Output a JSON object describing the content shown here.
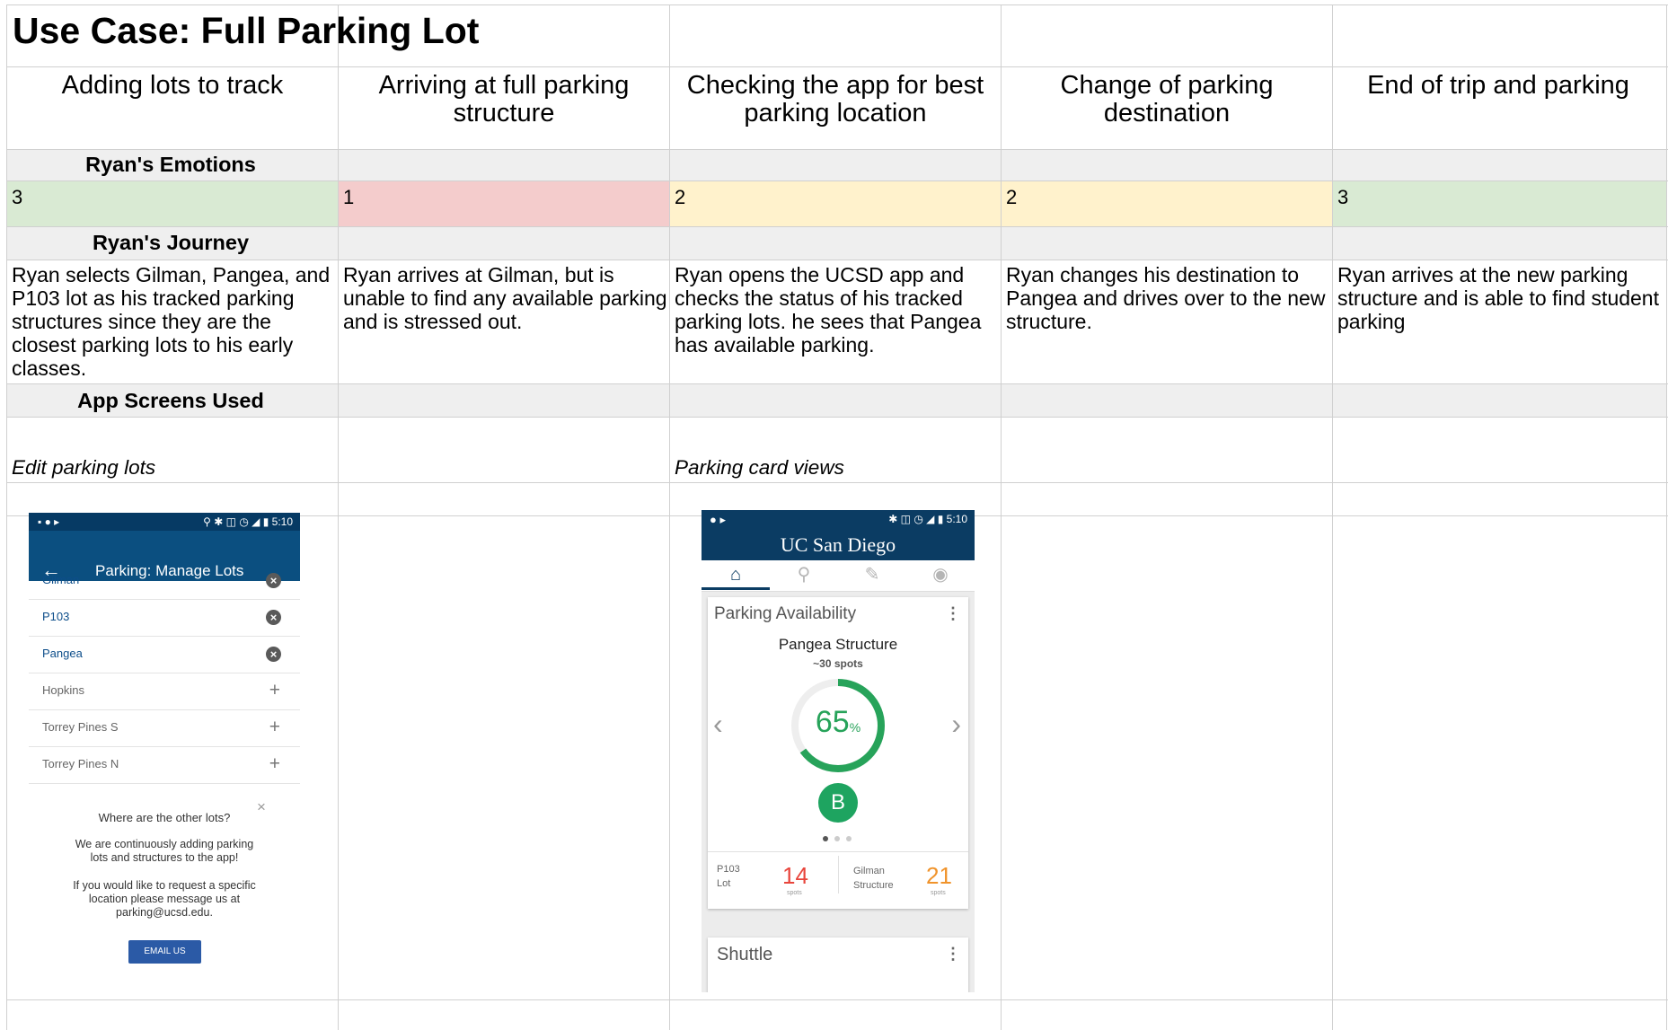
{
  "title": "Use Case: Full Parking Lot",
  "phases": [
    "Adding lots to track",
    "Arriving at full parking structure",
    "Checking the app for best parking location",
    "Change of parking destination",
    "End of trip and parking"
  ],
  "sections": {
    "emotions": "Ryan's Emotions",
    "journey": "Ryan's Journey",
    "screens": "App Screens Used"
  },
  "emotion_scores": [
    {
      "value": "3",
      "color": "#d9ead3"
    },
    {
      "value": "1",
      "color": "#f4cccc"
    },
    {
      "value": "2",
      "color": "#fff2cc"
    },
    {
      "value": "2",
      "color": "#fff2cc"
    },
    {
      "value": "3",
      "color": "#d9ead3"
    }
  ],
  "journey": [
    "Ryan selects Gilman, Pangea, and P103 lot as his tracked parking structures since they are the closest parking lots to his early classes.",
    "Ryan arrives at Gilman, but is unable to find any available parking and is stressed out.",
    "Ryan opens the UCSD app and checks the status of his tracked parking lots. he sees that Pangea has available parking.",
    "Ryan changes his destination to Pangea and drives over to the new structure.",
    "Ryan arrives at the new parking structure and is able to find student parking"
  ],
  "screen_labels": {
    "col1": "Edit parking lots",
    "col3": "Parking card views"
  },
  "manage_lots_screen": {
    "time": "5:10",
    "title": "Parking: Manage Lots",
    "tracked": [
      "Gilman",
      "P103",
      "Pangea"
    ],
    "untracked": [
      "Hopkins",
      "Torrey Pines S",
      "Torrey Pines N"
    ],
    "info_heading": "Where are the other lots?",
    "info_line1": "We are continuously adding parking",
    "info_line2": "lots and structures to the app!",
    "info_line3": "If you would like to request a specific",
    "info_line4": "location please message us at",
    "info_line5": "parking@ucsd.edu.",
    "email_button": "EMAIL US",
    "icons": [
      "back-arrow-icon",
      "remove-icon",
      "add-icon",
      "close-icon"
    ]
  },
  "card_screen": {
    "time": "5:10",
    "logo": "UC San Diego",
    "card_title": "Parking Availability",
    "structure": "Pangea Structure",
    "spots": "~30 spots",
    "percent": 65,
    "percent_sign": "%",
    "grade": "B",
    "accent": "#27a35a",
    "others": [
      {
        "name1": "P103",
        "name2": "Lot",
        "value": "14",
        "unit": "spots",
        "color": "#e8453c"
      },
      {
        "name1": "Gilman",
        "name2": "Structure",
        "value": "21",
        "unit": "spots",
        "color": "#f0932b"
      }
    ],
    "second_card_title": "Shuttle",
    "icons": [
      "home-icon",
      "map-pin-icon",
      "edit-icon",
      "profile-icon"
    ]
  }
}
